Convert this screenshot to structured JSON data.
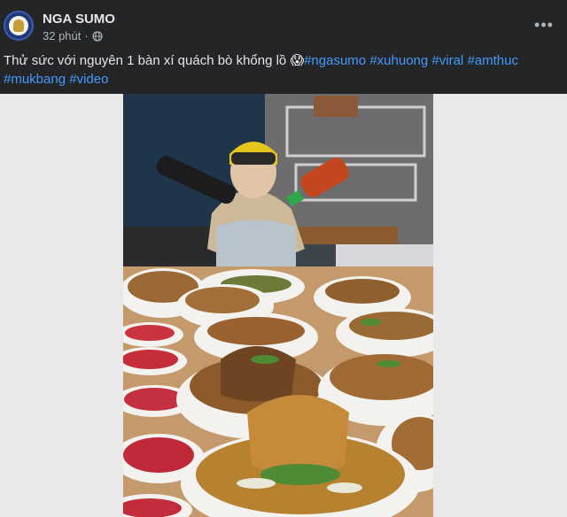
{
  "post": {
    "page_name": "NGA SUMO",
    "time": "32 phút",
    "privacy_icon": "globe-icon",
    "more_icon": "more-horizontal-icon",
    "caption_text": "Thử sức với nguyên 1 bàn xí quách bò khổng lồ ",
    "caption_emoji": "😱",
    "hashtags": [
      "#ngasumo",
      "#xuhuong",
      "#viral",
      "#amthuc",
      "#mukbang",
      "#video"
    ]
  },
  "colors": {
    "background": "#242526",
    "text": "#e4e6eb",
    "secondary_text": "#b0b3b8",
    "hashtag": "#4599ff",
    "media_backdrop": "#e9e9ea"
  }
}
